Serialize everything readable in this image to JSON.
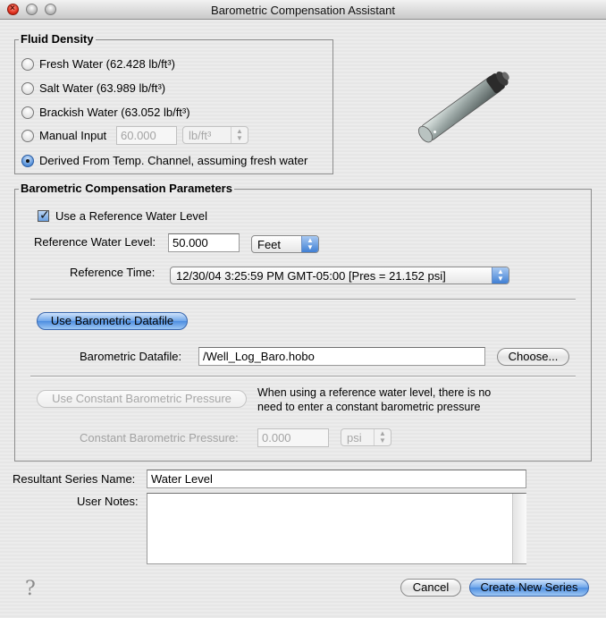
{
  "window": {
    "title": "Barometric Compensation Assistant"
  },
  "fluid_density": {
    "legend": "Fluid Density",
    "options": [
      {
        "label": "Fresh Water (62.428 lb/ft³)",
        "selected": false
      },
      {
        "label": "Salt Water (63.989 lb/ft³)",
        "selected": false
      },
      {
        "label": "Brackish Water (63.052 lb/ft³)",
        "selected": false
      },
      {
        "label": "Manual Input",
        "selected": false
      },
      {
        "label": "Derived From Temp. Channel, assuming fresh water",
        "selected": true
      }
    ],
    "manual_value": "60.000",
    "manual_unit": "lb/ft³"
  },
  "params": {
    "legend": "Barometric Compensation Parameters",
    "use_reference_label": "Use a Reference Water Level",
    "use_reference_checked": true,
    "ref_level_label": "Reference Water Level:",
    "ref_level_value": "50.000",
    "ref_level_unit": "Feet",
    "ref_time_label": "Reference Time:",
    "ref_time_value": "12/30/04 3:25:59 PM GMT-05:00 [Pres = 21.152 psi]",
    "use_datafile_button": "Use Barometric Datafile",
    "datafile_label": "Barometric Datafile:",
    "datafile_value": "/Well_Log_Baro.hobo",
    "choose_button": "Choose...",
    "use_constant_button": "Use Constant Barometric Pressure",
    "constant_note": "When using a reference water level, there is no need to enter a constant barometric pressure",
    "constant_label": "Constant Barometric Pressure:",
    "constant_value": "0.000",
    "constant_unit": "psi"
  },
  "series": {
    "name_label": "Resultant Series Name:",
    "name_value": "Water Level",
    "notes_label": "User Notes:",
    "notes_value": ""
  },
  "footer": {
    "help_icon": "?",
    "cancel_button": "Cancel",
    "create_button": "Create New Series"
  },
  "icons": {
    "sensor": "sensor-logger-icon",
    "help": "help-icon"
  }
}
